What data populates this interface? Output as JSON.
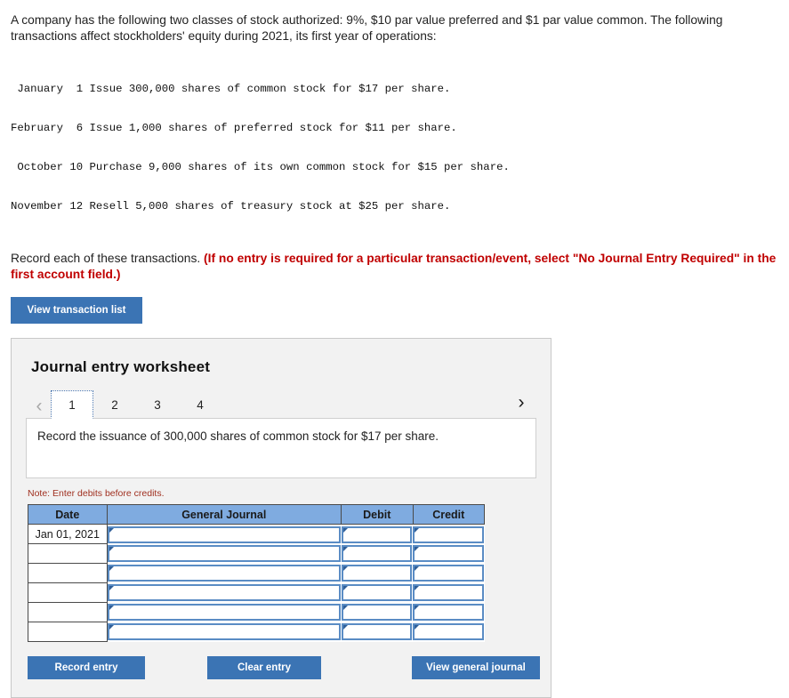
{
  "intro": {
    "paragraph": "A company has the following two classes of stock authorized: 9%, $10 par value preferred and $1 par value common. The following transactions affect stockholders' equity during 2021, its first year of operations:"
  },
  "transactions": [
    " January  1 Issue 300,000 shares of common stock for $17 per share.",
    "February  6 Issue 1,000 shares of preferred stock for $11 per share.",
    " October 10 Purchase 9,000 shares of its own common stock for $15 per share.",
    "November 12 Resell 5,000 shares of treasury stock at $25 per share."
  ],
  "instruction": {
    "lead": "Record each of these transactions. ",
    "required": "(If no entry is required for a particular transaction/event, select \"No Journal Entry Required\" in the first account field.)"
  },
  "buttons": {
    "view_transaction_list": "View transaction list",
    "record_entry": "Record entry",
    "clear_entry": "Clear entry",
    "view_general_journal": "View general journal"
  },
  "worksheet": {
    "title": "Journal entry worksheet",
    "prev_icon": "chevron-left-icon",
    "next_icon": "chevron-right-icon",
    "prev_glyph": "‹",
    "next_glyph": "›",
    "tabs": [
      "1",
      "2",
      "3",
      "4"
    ],
    "active_tab": "1",
    "description": "Record the issuance of 300,000 shares of common stock for $17 per share.",
    "note": "Note: Enter debits before credits."
  },
  "journal_table": {
    "headers": [
      "Date",
      "General Journal",
      "Debit",
      "Credit"
    ],
    "rows": [
      {
        "date": "Jan 01, 2021",
        "general_journal": "",
        "debit": "",
        "credit": ""
      },
      {
        "date": "",
        "general_journal": "",
        "debit": "",
        "credit": ""
      },
      {
        "date": "",
        "general_journal": "",
        "debit": "",
        "credit": ""
      },
      {
        "date": "",
        "general_journal": "",
        "debit": "",
        "credit": ""
      },
      {
        "date": "",
        "general_journal": "",
        "debit": "",
        "credit": ""
      },
      {
        "date": "",
        "general_journal": "",
        "debit": "",
        "credit": ""
      }
    ]
  },
  "colors": {
    "button_blue": "#3b74b4",
    "header_blue": "#7fabe0",
    "required_red": "#c00000",
    "note_red": "#a03020",
    "panel_bg": "#f2f2f2",
    "input_border_blue": "#5a8cc4"
  }
}
